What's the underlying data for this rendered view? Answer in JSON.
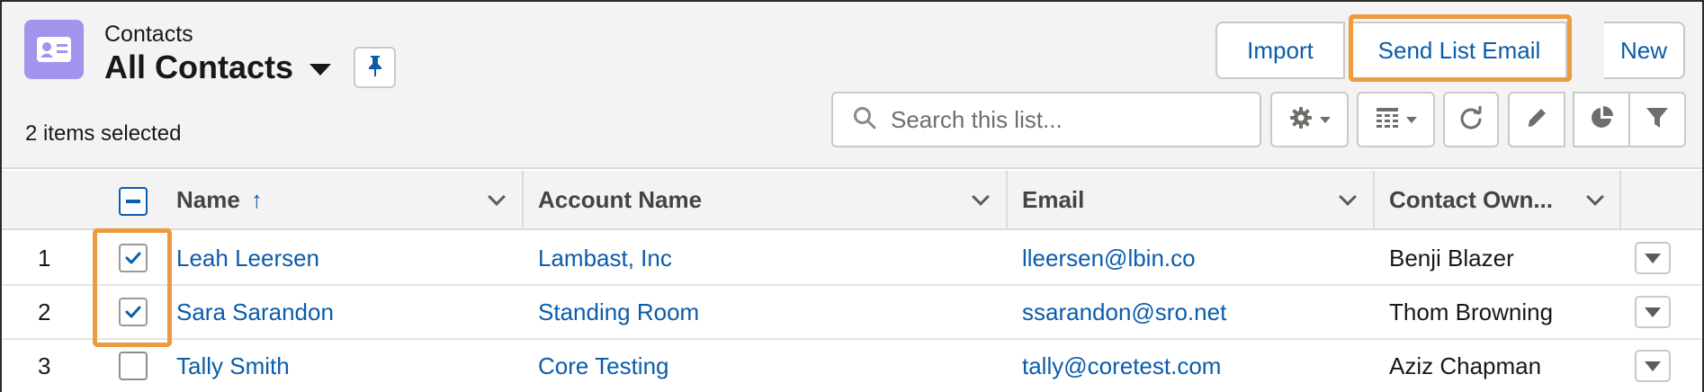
{
  "header": {
    "object_label": "Contacts",
    "list_view_name": "All Contacts",
    "selected_count": "2 items selected",
    "icons": {
      "app": "contact-card-icon",
      "list_switcher": "caret-down-icon",
      "pin": "pin-icon"
    }
  },
  "actions": {
    "import_label": "Import",
    "send_list_email_label": "Send List Email",
    "new_label": "New"
  },
  "search": {
    "placeholder": "Search this list..."
  },
  "toolbar": {
    "icons": [
      "gear-icon",
      "table-display-icon",
      "refresh-icon",
      "pencil-icon",
      "pie-chart-icon",
      "filter-icon"
    ]
  },
  "table": {
    "columns": [
      {
        "label": "Name",
        "sort": "ascending"
      },
      {
        "label": "Account Name"
      },
      {
        "label": "Email"
      },
      {
        "label": "Contact Own..."
      }
    ],
    "sort_indicator": "↑",
    "rows": [
      {
        "num": "1",
        "name": "Leah Leersen",
        "account": "Lambast, Inc",
        "email": "lleersen@lbin.co",
        "owner": "Benji Blazer",
        "selected": true
      },
      {
        "num": "2",
        "name": "Sara Sarandon",
        "account": "Standing Room",
        "email": "ssarandon@sro.net",
        "owner": "Thom Browning",
        "selected": true
      },
      {
        "num": "3",
        "name": "Tally Smith",
        "account": "Core Testing",
        "email": "tally@coretest.com",
        "owner": "Aziz Chapman",
        "selected": false
      }
    ]
  },
  "colors": {
    "link": "#0b5cab",
    "app_icon_bg": "#a094ed",
    "highlight": "#ee9a3f",
    "header_bg": "#f3f3f3"
  }
}
